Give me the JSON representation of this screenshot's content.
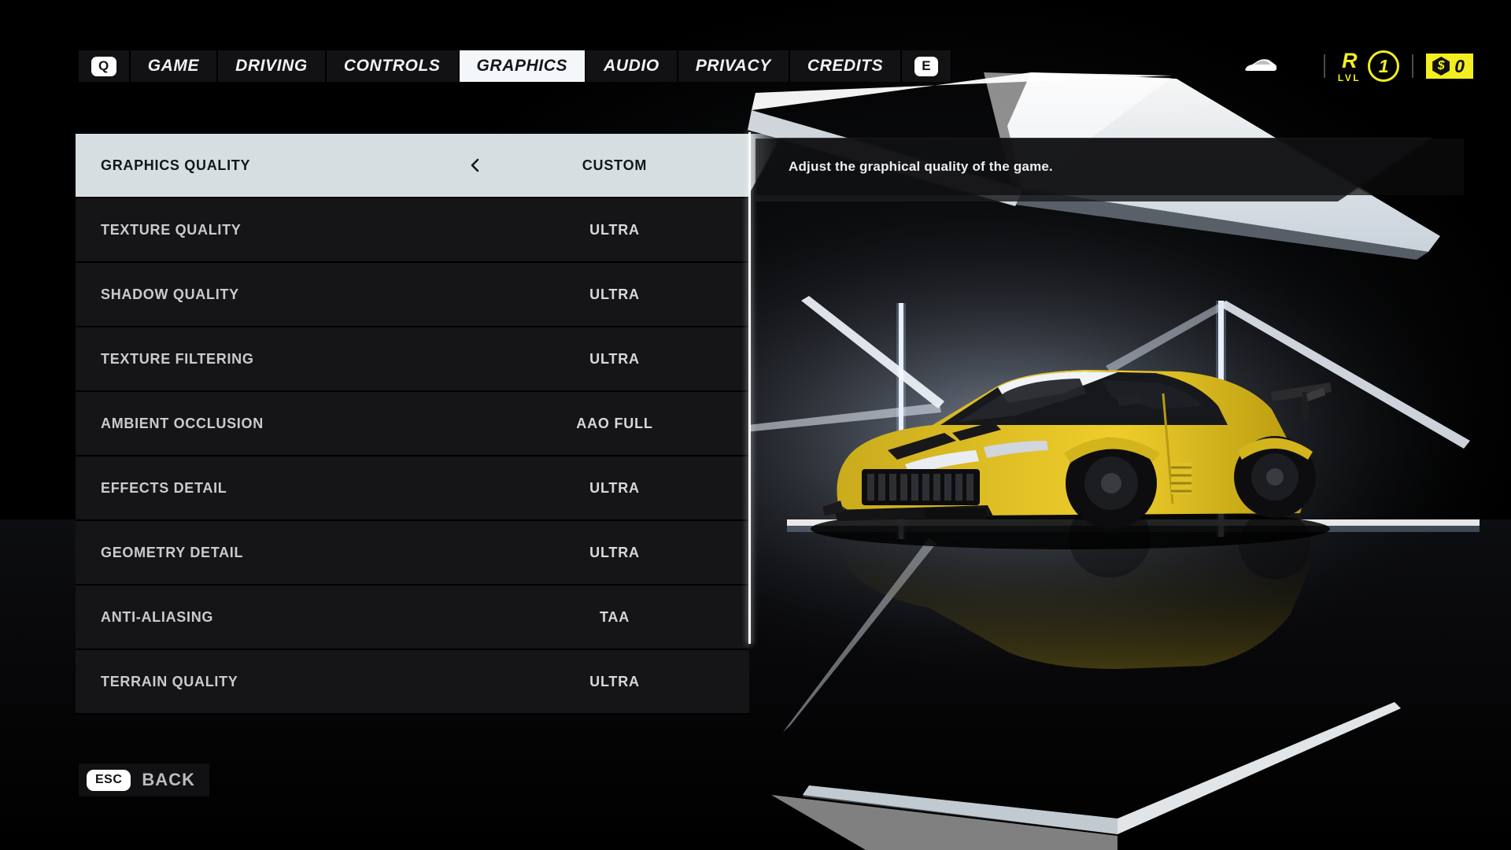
{
  "nav": {
    "prev_key": "Q",
    "next_key": "E",
    "tabs": [
      {
        "label": "GAME",
        "active": false
      },
      {
        "label": "DRIVING",
        "active": false
      },
      {
        "label": "CONTROLS",
        "active": false
      },
      {
        "label": "GRAPHICS",
        "active": true
      },
      {
        "label": "AUDIO",
        "active": false
      },
      {
        "label": "PRIVACY",
        "active": false
      },
      {
        "label": "CREDITS",
        "active": false
      }
    ]
  },
  "hud": {
    "car_icon": "car-icon",
    "rank_letter": "R",
    "rank_sub": "LVL",
    "level": "1",
    "currency_symbol": "$",
    "currency_amount": "0",
    "accent_color": "#f2ee20"
  },
  "settings": {
    "rows": [
      {
        "label": "GRAPHICS QUALITY",
        "value": "CUSTOM",
        "selected": true,
        "has_arrow": true
      },
      {
        "label": "TEXTURE QUALITY",
        "value": "ULTRA",
        "selected": false,
        "has_arrow": false
      },
      {
        "label": "SHADOW QUALITY",
        "value": "ULTRA",
        "selected": false,
        "has_arrow": false
      },
      {
        "label": "TEXTURE FILTERING",
        "value": "ULTRA",
        "selected": false,
        "has_arrow": false
      },
      {
        "label": "AMBIENT OCCLUSION",
        "value": "AAO FULL",
        "selected": false,
        "has_arrow": false
      },
      {
        "label": "EFFECTS DETAIL",
        "value": "ULTRA",
        "selected": false,
        "has_arrow": false
      },
      {
        "label": "GEOMETRY DETAIL",
        "value": "ULTRA",
        "selected": false,
        "has_arrow": false
      },
      {
        "label": "ANTI-ALIASING",
        "value": "TAA",
        "selected": false,
        "has_arrow": false
      },
      {
        "label": "TERRAIN QUALITY",
        "value": "ULTRA",
        "selected": false,
        "has_arrow": false
      }
    ]
  },
  "tooltip": {
    "text": "Adjust the graphical quality of the game."
  },
  "footer": {
    "key": "ESC",
    "label": "BACK"
  },
  "theme": {
    "background": "#000000",
    "row_bg": "#151518",
    "selected_bg": "#d6dee1",
    "text_light": "#c9cbce",
    "accent_yellow": "#f2ee20",
    "car_body": "#e8c832"
  }
}
